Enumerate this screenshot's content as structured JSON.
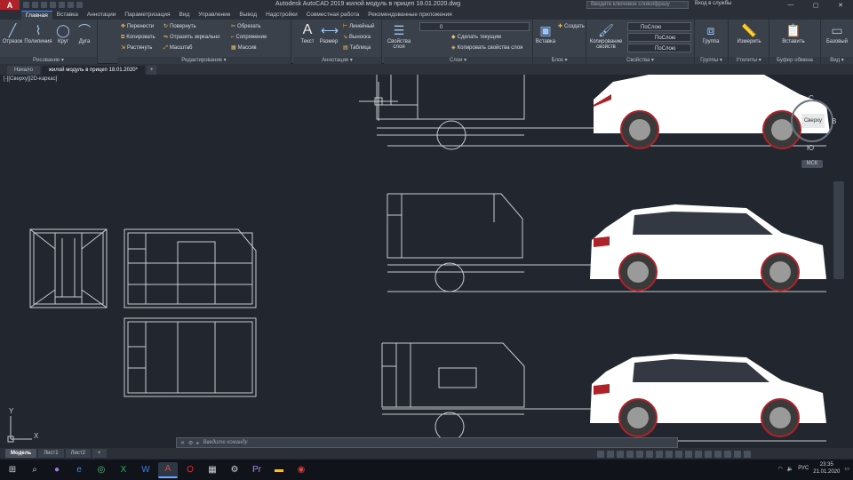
{
  "titlebar": {
    "logo": "A",
    "title": "Autodesk AutoCAD 2019   жилой модуль в прицеп 18.01.2020.dwg",
    "search_placeholder": "Введите ключевое слово/фразу",
    "user": "Вход в службы",
    "controls": [
      "—",
      "▢",
      "✕"
    ]
  },
  "ribbon_tabs": [
    "Главная",
    "Вставка",
    "Аннотации",
    "Параметризация",
    "Вид",
    "Управление",
    "Вывод",
    "Надстройки",
    "Совместная работа",
    "Рекомендованные приложения"
  ],
  "panels": {
    "draw": {
      "title": "Рисование ▾",
      "tools": [
        {
          "label": "Отрезок",
          "icon": "line-icon"
        },
        {
          "label": "Полилиния",
          "icon": "polyline-icon"
        },
        {
          "label": "Круг",
          "icon": "circle-icon"
        },
        {
          "label": "Дуга",
          "icon": "arc-icon"
        }
      ]
    },
    "modify": {
      "title": "Редактирование ▾",
      "tools": [
        "Перенести",
        "Повернуть",
        "Обрезать",
        "Копировать",
        "Отразить зеркально",
        "Сопряжение",
        "Растянуть",
        "Масштаб",
        "Массив"
      ]
    },
    "annotation": {
      "title": "Аннотации ▾",
      "tools": [
        "Текст",
        "Размер"
      ],
      "small": [
        "Линейный",
        "Выноска",
        "Таблица"
      ]
    },
    "layers": {
      "title": "Слои ▾",
      "big": "Свойства слоя",
      "combo": "0",
      "small": [
        "Сделать текущим",
        "Копировать свойства слоя"
      ]
    },
    "block": {
      "title": "Блок ▾",
      "big": "Вставка",
      "small": [
        "Создать"
      ]
    },
    "properties": {
      "title": "Свойства ▾",
      "big": "Копирование свойств",
      "combos": [
        "ПоСлою",
        "ПоСлою",
        "ПоСлою"
      ]
    },
    "groups": {
      "title": "Группы ▾",
      "big": "Группа"
    },
    "utilities": {
      "title": "Утилиты ▾",
      "big": "Измерить"
    },
    "clipboard": {
      "title": "Буфер обмена",
      "big": "Вставить"
    },
    "view": {
      "title": "Вид ▾",
      "big": "Базовый"
    }
  },
  "doc_tabs": [
    "Начало",
    "жилой модуль в прицеп 18.01.2020*",
    "+"
  ],
  "viewport": {
    "label": "[-][Сверху][2D-каркас]",
    "viewcube": {
      "top": "С",
      "face": "Сверху",
      "east": "В",
      "south": "Ю",
      "wcs": "МСК"
    }
  },
  "ucs": {
    "y": "Y",
    "x": "X"
  },
  "layout_tabs": [
    "Модель",
    "Лист1",
    "Лист2",
    "+"
  ],
  "command_line": {
    "placeholder": "Введите команду"
  },
  "taskbar": {
    "icons": [
      "windows-icon",
      "search-icon",
      "cortana-icon",
      "edge-icon",
      "whatsapp-icon",
      "excel-icon",
      "word-icon",
      "autocad-icon",
      "opera-icon",
      "calculator-icon",
      "settings-icon",
      "premiere-icon",
      "explorer-icon",
      "recorder-icon"
    ],
    "lang": "РУС",
    "time": "23:35",
    "date": "21.01.2020"
  },
  "colors": {
    "canvas": "#21262f",
    "lines": "#c8ccd2",
    "car": "#ffffff",
    "wheel_rim": "#b0222a",
    "accent": "#b0222a"
  }
}
